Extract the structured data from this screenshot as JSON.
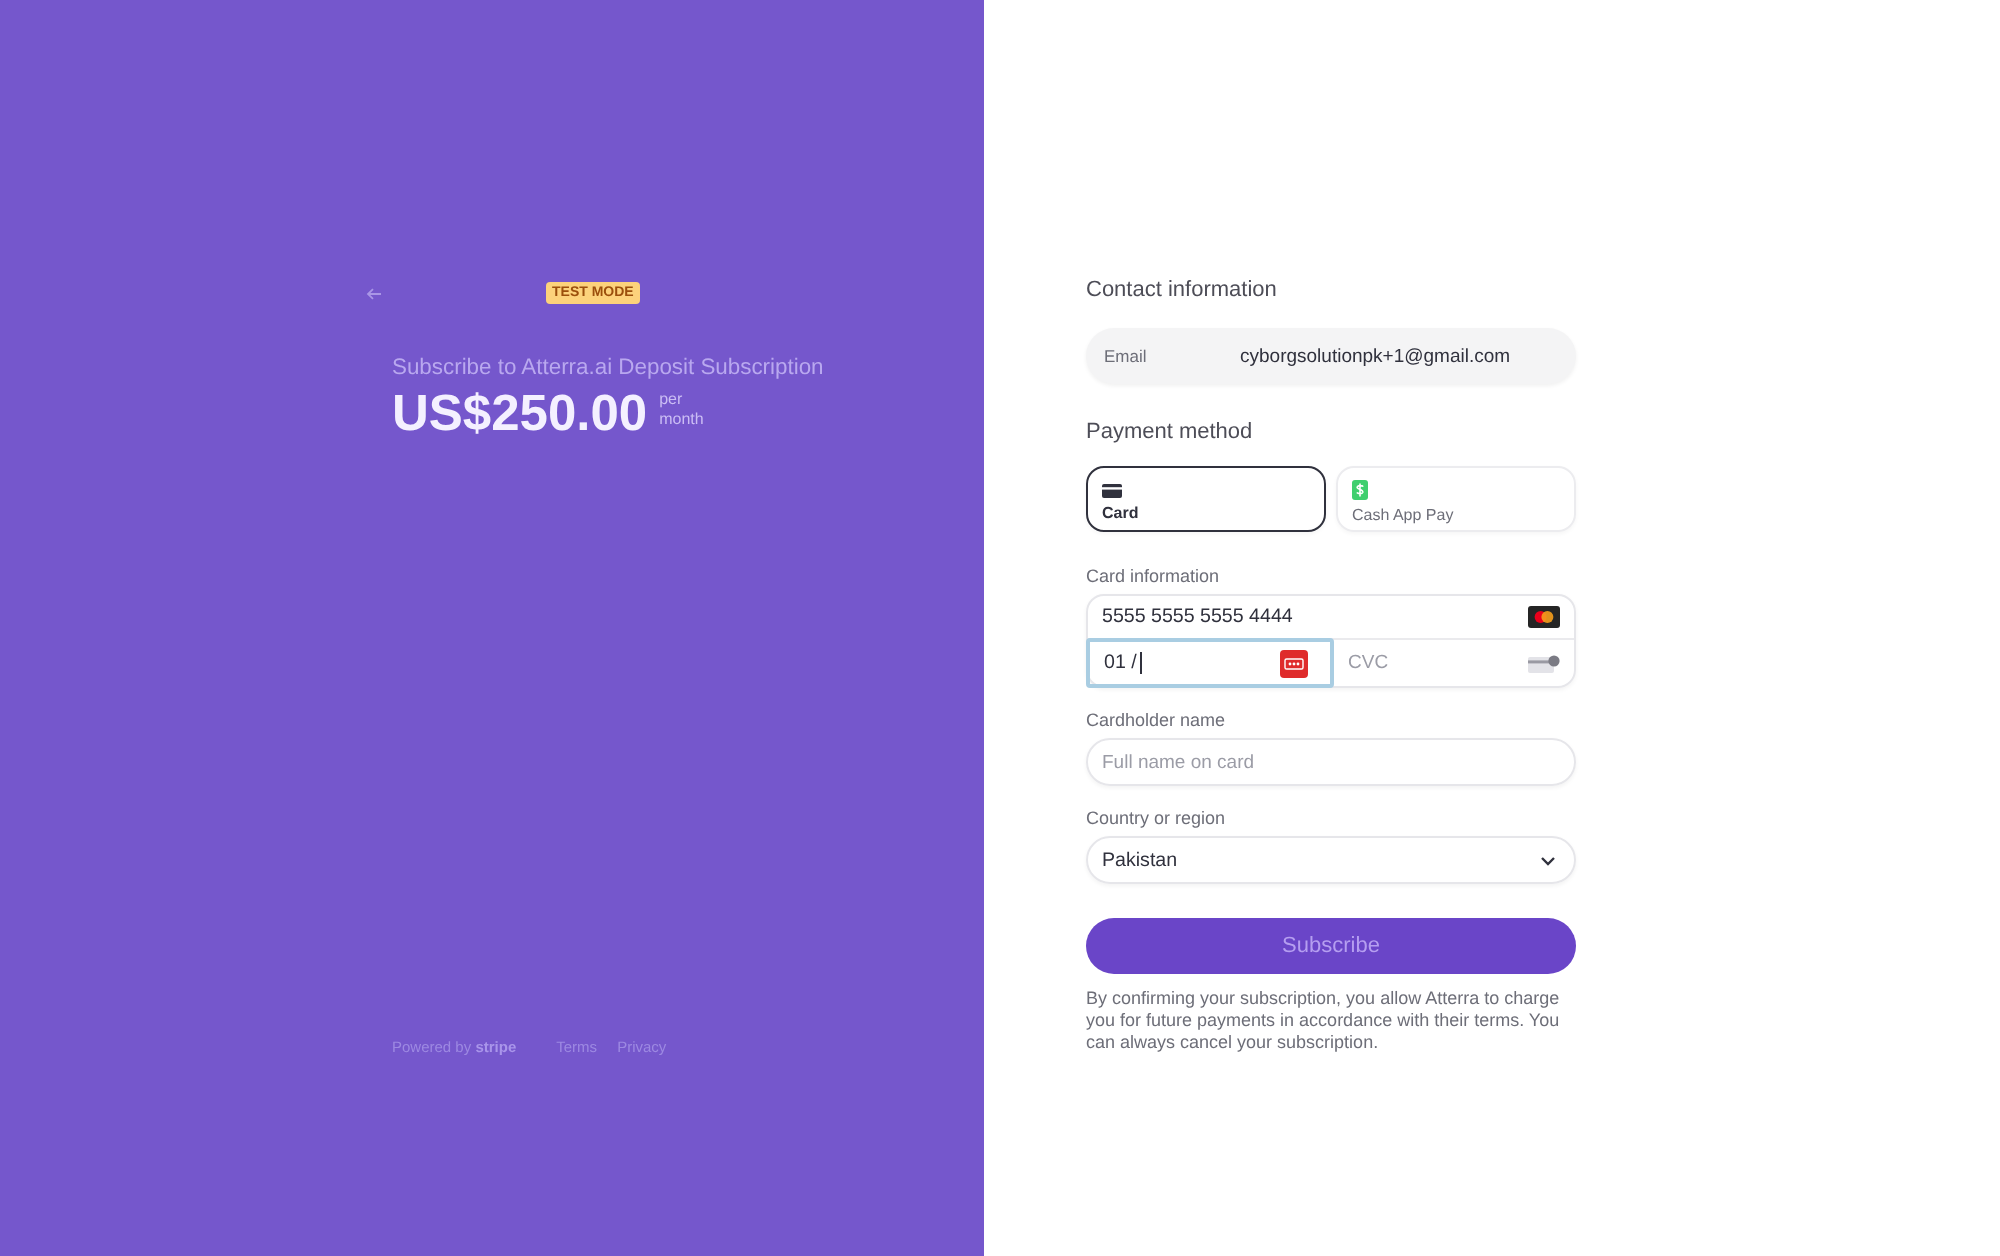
{
  "summary": {
    "badge": "TEST MODE",
    "title": "Subscribe to Atterra.ai Deposit Subscription",
    "price": "US$250.00",
    "period": "per month"
  },
  "footer": {
    "powered_by": "Powered by",
    "brand": "stripe",
    "links": [
      "Terms",
      "Privacy"
    ]
  },
  "contact": {
    "heading": "Contact information",
    "email": {
      "label": "Email",
      "value": "cyborgsolutionpk+1@gmail.com"
    }
  },
  "payment": {
    "heading": "Payment method",
    "methods": [
      {
        "kind": "card",
        "label": "Card",
        "selected": true
      },
      {
        "kind": "cashapp",
        "label": "Cash App Pay",
        "selected": false
      }
    ]
  },
  "card_information": {
    "label": "Card information",
    "number": "5555 5555 5555 4444",
    "expiry": {
      "value": "01 /",
      "focused": true
    },
    "cvc": {
      "placeholder": "CVC",
      "focused": false
    }
  },
  "cardholder": {
    "label": "Cardholder name",
    "placeholder": "Full name on card"
  },
  "country": {
    "label": "Country or region",
    "value": "Pakistan"
  },
  "subscribe_button": "Subscribe",
  "disclaimer": "By confirming your subscription, you allow Atterra to charge you for future payments in accordance with their terms. You can always cancel your subscription."
}
